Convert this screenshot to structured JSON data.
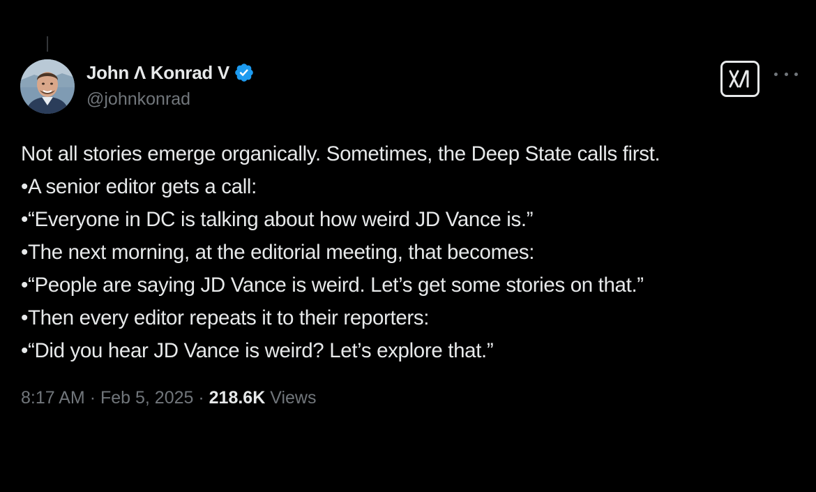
{
  "author": {
    "display_name": "John Λ Konrad V",
    "handle": "@johnkonrad",
    "verified_icon": "verified-badge-icon",
    "verified_color": "#1d9bf0",
    "avatar_icon": "profile-photo"
  },
  "actions": {
    "grok_icon": "grok-icon",
    "more_icon": "more-dots-icon"
  },
  "tweet": {
    "lines": [
      "Not all stories emerge organically. Sometimes, the Deep State calls first.",
      "•A senior editor gets a call:",
      "•“Everyone in DC is talking about how weird JD Vance is.”",
      "•The next morning, at the editorial meeting, that becomes:",
      "•“People are saying JD Vance is weird. Let’s get some stories on that.”",
      "•Then every editor repeats it to their reporters:",
      "•“Did you hear JD Vance is weird? Let’s explore that.”"
    ]
  },
  "meta": {
    "time": "8:17 AM",
    "separator": "·",
    "date": "Feb 5, 2025",
    "views_count": "218.6K",
    "views_label": "Views"
  },
  "colors": {
    "background": "#000000",
    "text_primary": "#e7e9ea",
    "text_secondary": "#71767b"
  }
}
